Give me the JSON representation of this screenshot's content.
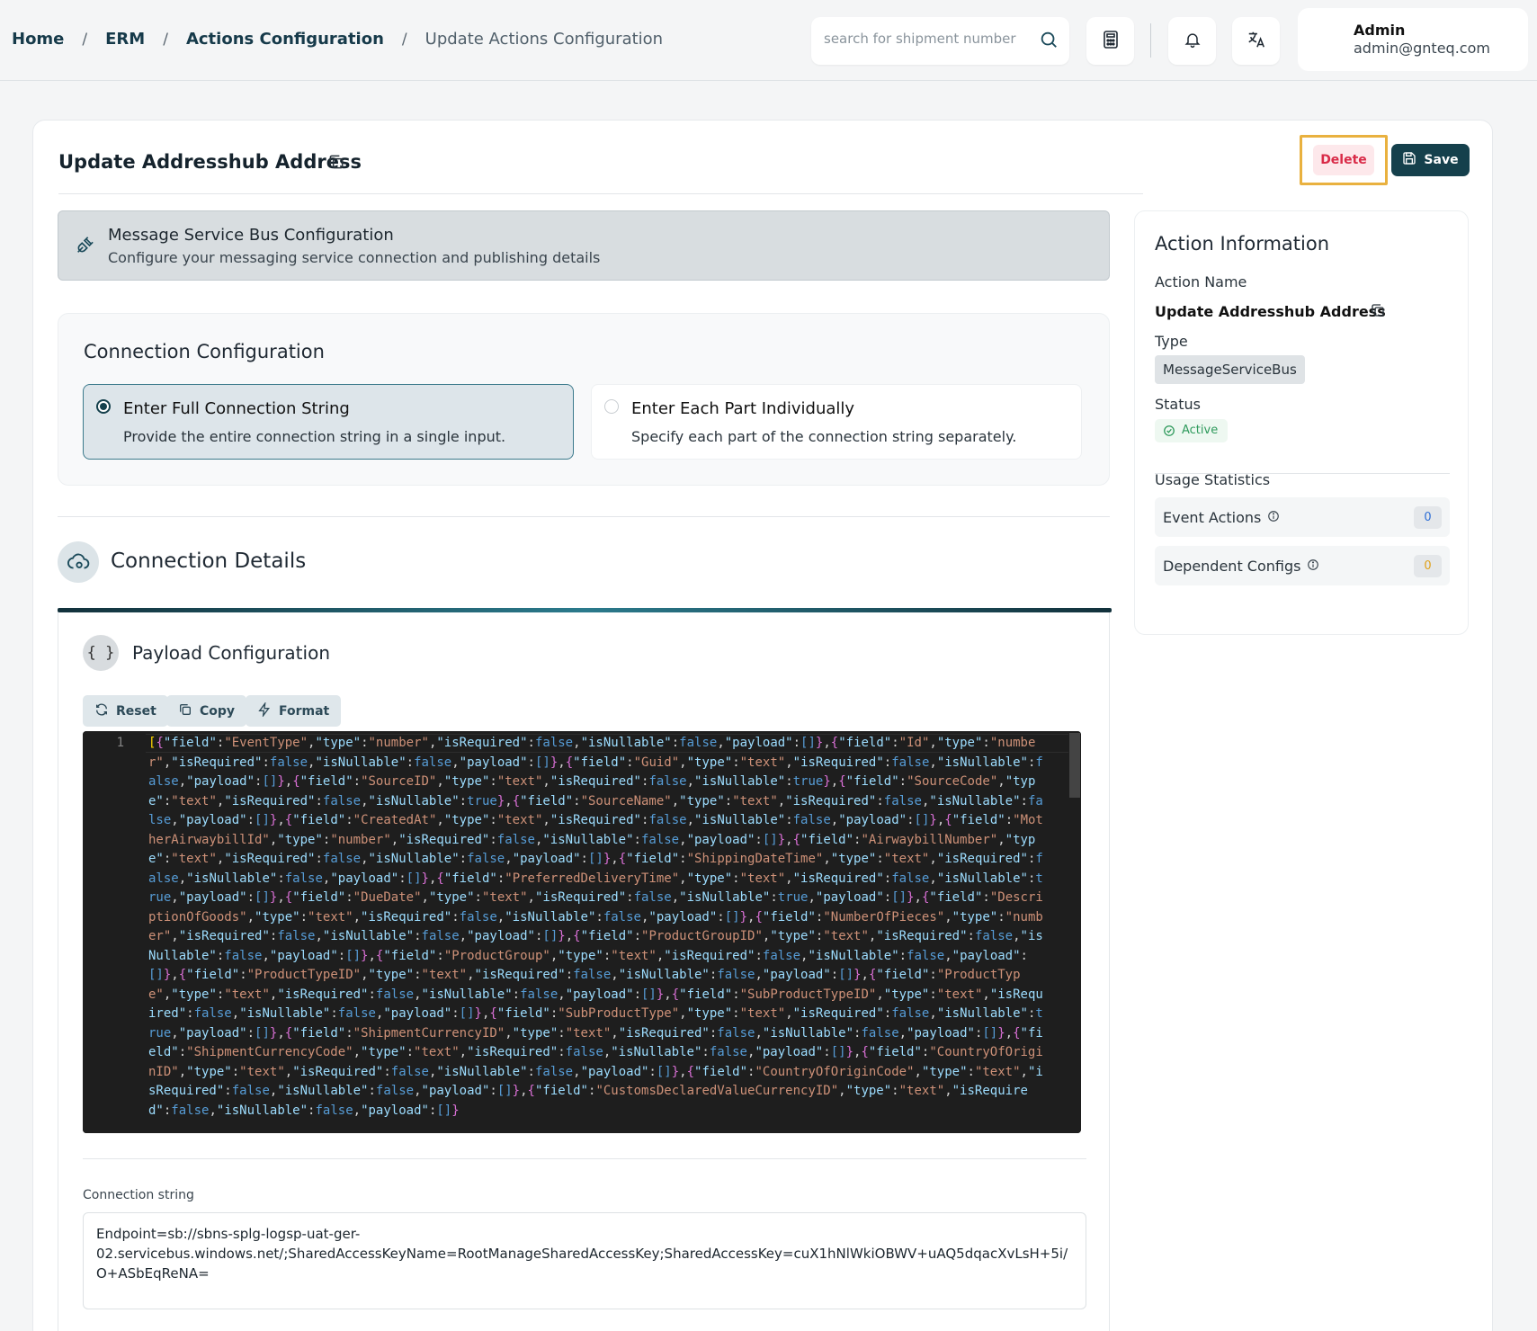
{
  "breadcrumb": {
    "home": "Home",
    "erm": "ERM",
    "actions_configuration": "Actions Configuration",
    "current": "Update Actions Configuration",
    "separator": "/"
  },
  "search": {
    "placeholder": "search for shipment number"
  },
  "user": {
    "name": "Admin",
    "email": "admin@gnteq.com"
  },
  "page": {
    "title": "Update Addresshub Address",
    "delete_label": "Delete",
    "save_label": "Save"
  },
  "banner": {
    "title": "Message Service Bus Configuration",
    "subtitle": "Configure your messaging service connection and publishing details"
  },
  "connection_configuration": {
    "title": "Connection Configuration",
    "options": [
      {
        "title": "Enter Full Connection String",
        "subtitle": "Provide the entire connection string in a single input.",
        "selected": true
      },
      {
        "title": "Enter Each Part Individually",
        "subtitle": "Specify each part of the connection string separately.",
        "selected": false
      }
    ]
  },
  "connection_details": {
    "title": "Connection Details"
  },
  "payload": {
    "title": "Payload Configuration",
    "icon_text": "{ }",
    "buttons": {
      "reset": "Reset",
      "copy": "Copy",
      "format": "Format"
    },
    "line_number": "1",
    "fields": [
      [
        "EventType",
        "number",
        false,
        false,
        true
      ],
      [
        "Id",
        "number",
        false,
        false,
        true
      ],
      [
        "Guid",
        "text",
        false,
        false,
        true
      ],
      [
        "SourceID",
        "text",
        false,
        true,
        false
      ],
      [
        "SourceCode",
        "text",
        false,
        true,
        false
      ],
      [
        "SourceName",
        "text",
        false,
        false,
        true
      ],
      [
        "CreatedAt",
        "text",
        false,
        false,
        true
      ],
      [
        "MotherAirwaybillId",
        "number",
        false,
        false,
        true
      ],
      [
        "AirwaybillNumber",
        "text",
        false,
        false,
        true
      ],
      [
        "ShippingDateTime",
        "text",
        false,
        false,
        true
      ],
      [
        "PreferredDeliveryTime",
        "text",
        false,
        true,
        true
      ],
      [
        "DueDate",
        "text",
        false,
        true,
        true
      ],
      [
        "DescriptionOfGoods",
        "text",
        false,
        false,
        true
      ],
      [
        "NumberOfPieces",
        "number",
        false,
        false,
        true
      ],
      [
        "ProductGroupID",
        "text",
        false,
        false,
        true
      ],
      [
        "ProductGroup",
        "text",
        false,
        false,
        true
      ],
      [
        "ProductTypeID",
        "text",
        false,
        false,
        true
      ],
      [
        "ProductType",
        "text",
        false,
        false,
        true
      ],
      [
        "SubProductTypeID",
        "text",
        false,
        false,
        true
      ],
      [
        "SubProductType",
        "text",
        false,
        true,
        true
      ],
      [
        "ShipmentCurrencyID",
        "text",
        false,
        false,
        true
      ],
      [
        "ShipmentCurrencyCode",
        "text",
        false,
        false,
        true
      ],
      [
        "CountryOfOriginID",
        "text",
        false,
        false,
        true
      ],
      [
        "CountryOfOriginCode",
        "text",
        false,
        false,
        true
      ],
      [
        "CustomsDeclaredValueCurrencyID",
        "text",
        false,
        false,
        true
      ]
    ]
  },
  "connection_string": {
    "label": "Connection string",
    "value": "Endpoint=sb://sbns-splg-logsp-uat-ger-02.servicebus.windows.net/;SharedAccessKeyName=RootManageSharedAccessKey;SharedAccessKey=cuX1hNlWkiOBWV+uAQ5dqacXvLsH+5i/O+ASbEqReNA="
  },
  "action_information": {
    "title": "Action Information",
    "name_label": "Action Name",
    "name": "Update Addresshub Address",
    "type_label": "Type",
    "type": "MessageServiceBus",
    "status_label": "Status",
    "status": "Active",
    "usage_label": "Usage Statistics",
    "stats": [
      {
        "label": "Event Actions",
        "count": "0",
        "color": "#2f6fd6"
      },
      {
        "label": "Dependent Configs",
        "count": "0",
        "color": "#e0a21c"
      }
    ]
  },
  "colors": {
    "primary": "#15404c",
    "delete": "#d92b48",
    "highlight": "#e9b13f",
    "active": "#2f9a5c"
  }
}
